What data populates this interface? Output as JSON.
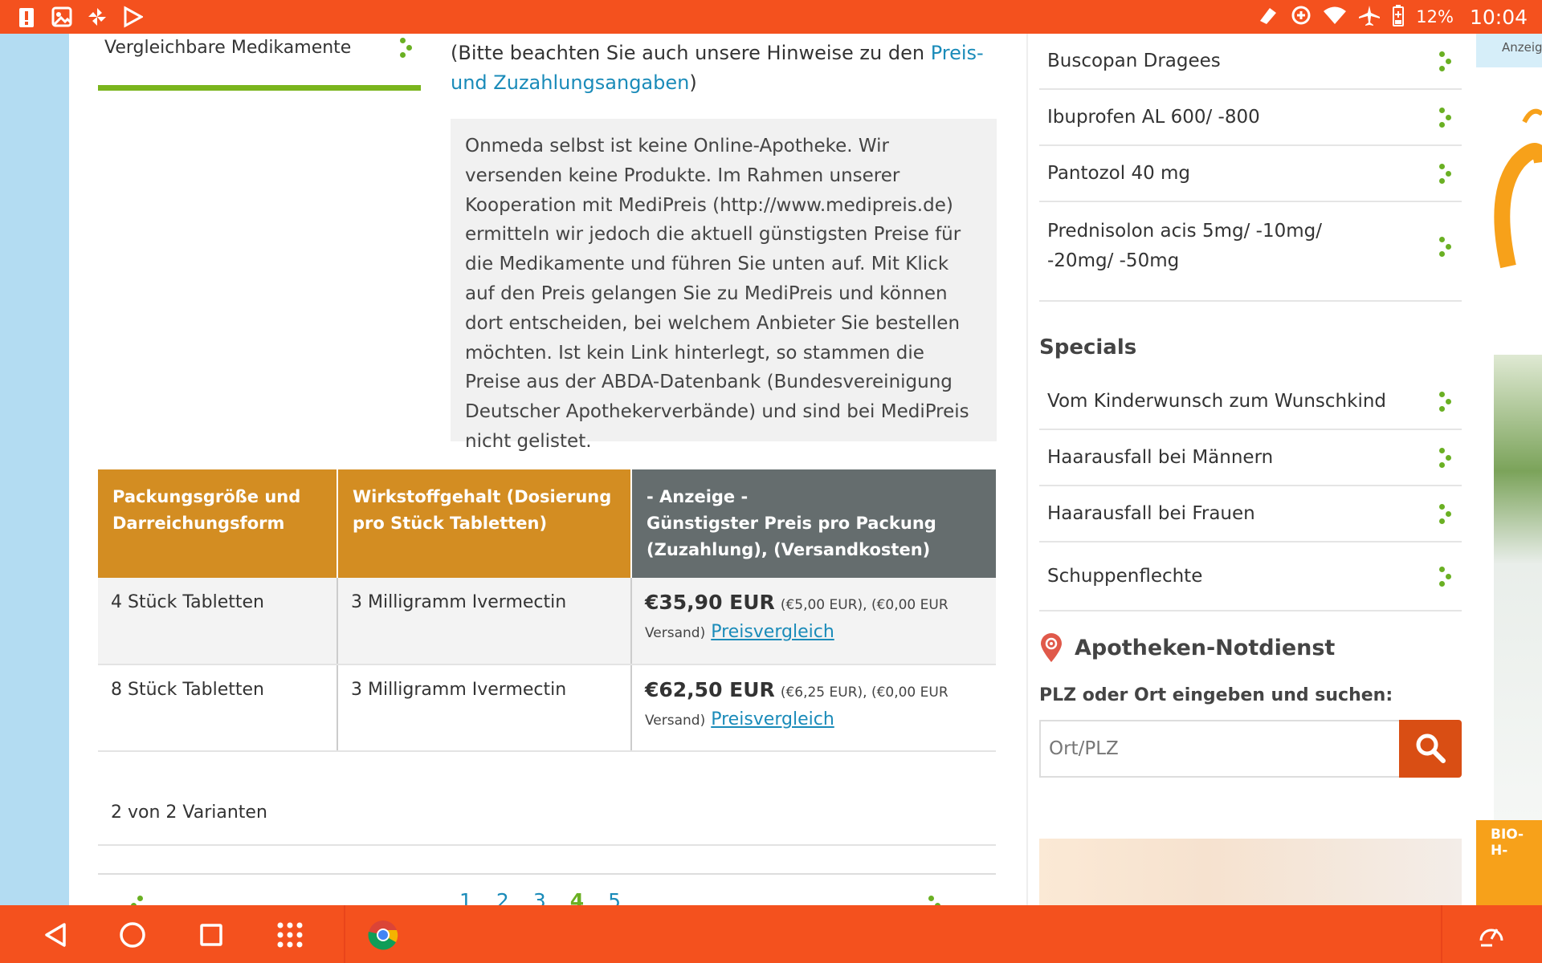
{
  "statusbar": {
    "battery_percent": "12%",
    "time": "10:04",
    "icons": [
      "alert-icon",
      "gallery-icon",
      "pinwheel-icon",
      "play-store-icon",
      "cast-icon",
      "data-saver-icon",
      "wifi-icon",
      "airplane-icon",
      "battery-icon"
    ]
  },
  "leftnav": {
    "item_label": "Vergleichbare Medikamente"
  },
  "note": {
    "prefix": "(Bitte beachten Sie auch unsere Hinweise zu den ",
    "link_text": "Preis- und Zuzahlungsangaben",
    "suffix": ")"
  },
  "infobox": {
    "text": "Onmeda selbst ist keine Online-Apotheke. Wir versenden keine Produkte. Im Rahmen unserer Kooperation mit MediPreis (http://www.medipreis.de) ermitteln wir jedoch die aktuell günstigsten Preise für die Medikamente und führen Sie unten auf. Mit Klick auf den Preis gelangen Sie zu MediPreis und können dort entscheiden, bei welchem Anbieter Sie bestellen möchten. Ist kein Link hinterlegt, so stammen die Preise aus der ABDA-Datenbank (Bundesvereinigung Deutscher Apothekerverbände) und sind bei MediPreis nicht gelistet."
  },
  "table": {
    "headers": {
      "col1": "Packungsgröße und Darreichungsform",
      "col2": "Wirkstoffgehalt (Dosierung pro Stück Tabletten)",
      "col3_line1": "- Anzeige -",
      "col3_line2": "Günstigster Preis pro Packung (Zuzahlung), (Versandkosten)"
    },
    "rows": [
      {
        "size": "4 Stück Tabletten",
        "dose": "3 Milligramm Ivermectin",
        "price": "€35,90 EUR",
        "details": "(€5,00 EUR), (€0,00 EUR Versand)",
        "link": "Preisvergleich"
      },
      {
        "size": "8 Stück Tabletten",
        "dose": "3 Milligramm Ivermectin",
        "price": "€62,50 EUR",
        "details": "(€6,25 EUR), (€0,00 EUR Versand)",
        "link": "Preisvergleich"
      }
    ],
    "variants": "2 von 2 Varianten"
  },
  "pager": {
    "pages": [
      "1",
      "2",
      "3",
      "4",
      "5"
    ],
    "current": "4"
  },
  "sidebar": {
    "related": [
      "Buscopan Dragees",
      "Ibuprofen AL 600/ -800",
      "Pantozol 40 mg",
      "Prednisolon acis 5mg/ -10mg/ -20mg/ -50mg"
    ],
    "specials_title": "Specials",
    "specials": [
      "Vom Kinderwunsch zum Wunschkind",
      "Haarausfall bei Männern",
      "Haarausfall bei Frauen",
      "Schuppenflechte"
    ],
    "notdienst_title": "Apotheken-Notdienst",
    "plz_label": "PLZ oder Ort eingeben und suchen:",
    "plz_placeholder": "Ort/PLZ"
  },
  "ad": {
    "label": "Anzeig",
    "brand": "BIO-H-"
  },
  "colors": {
    "system_bar": "#f4511e",
    "accent_green": "#6ab023",
    "table_header_orange": "#d38d22",
    "table_header_gray": "#656d6e",
    "link_blue": "#1a8bb9",
    "search_button": "#d94e14"
  }
}
